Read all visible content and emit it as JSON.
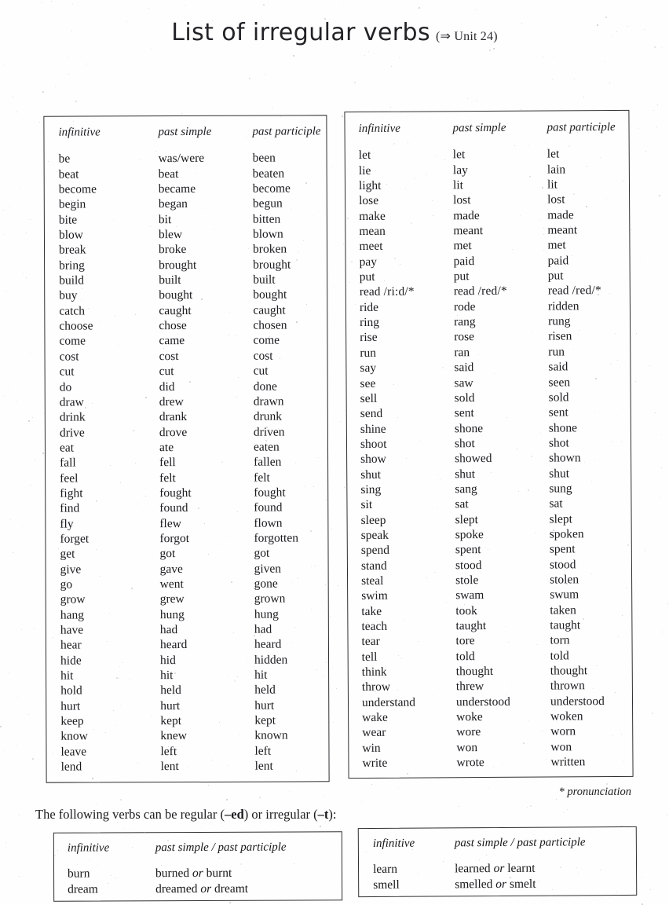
{
  "title": {
    "main": "List of irregular verbs",
    "unit_ref": "(⇒ Unit 24)"
  },
  "columns": {
    "infinitive": "infinitive",
    "past_simple": "past simple",
    "past_participle": "past participle",
    "past_simple_participle": "past simple / past participle"
  },
  "left_table": {
    "rows": [
      {
        "infinitive": "be",
        "past_simple": "was/were",
        "past_participle": "been"
      },
      {
        "infinitive": "beat",
        "past_simple": "beat",
        "past_participle": "beaten"
      },
      {
        "infinitive": "become",
        "past_simple": "became",
        "past_participle": "become"
      },
      {
        "infinitive": "begin",
        "past_simple": "began",
        "past_participle": "begun"
      },
      {
        "infinitive": "bite",
        "past_simple": "bit",
        "past_participle": "bitten"
      },
      {
        "infinitive": "blow",
        "past_simple": "blew",
        "past_participle": "blown"
      },
      {
        "infinitive": "break",
        "past_simple": "broke",
        "past_participle": "broken"
      },
      {
        "infinitive": "bring",
        "past_simple": "brought",
        "past_participle": "brought"
      },
      {
        "infinitive": "build",
        "past_simple": "built",
        "past_participle": "built"
      },
      {
        "infinitive": "buy",
        "past_simple": "bought",
        "past_participle": "bought"
      },
      {
        "infinitive": "catch",
        "past_simple": "caught",
        "past_participle": "caught"
      },
      {
        "infinitive": "choose",
        "past_simple": "chose",
        "past_participle": "chosen"
      },
      {
        "infinitive": "come",
        "past_simple": "came",
        "past_participle": "come"
      },
      {
        "infinitive": "cost",
        "past_simple": "cost",
        "past_participle": "cost"
      },
      {
        "infinitive": "cut",
        "past_simple": "cut",
        "past_participle": "cut"
      },
      {
        "infinitive": "do",
        "past_simple": "did",
        "past_participle": "done"
      },
      {
        "infinitive": "draw",
        "past_simple": "drew",
        "past_participle": "drawn"
      },
      {
        "infinitive": "drink",
        "past_simple": "drank",
        "past_participle": "drunk"
      },
      {
        "infinitive": "drive",
        "past_simple": "drove",
        "past_participle": "driven"
      },
      {
        "infinitive": "eat",
        "past_simple": "ate",
        "past_participle": "eaten"
      },
      {
        "infinitive": "fall",
        "past_simple": "fell",
        "past_participle": "fallen"
      },
      {
        "infinitive": "feel",
        "past_simple": "felt",
        "past_participle": "felt"
      },
      {
        "infinitive": "fight",
        "past_simple": "fought",
        "past_participle": "fought"
      },
      {
        "infinitive": "find",
        "past_simple": "found",
        "past_participle": "found"
      },
      {
        "infinitive": "fly",
        "past_simple": "flew",
        "past_participle": "flown"
      },
      {
        "infinitive": "forget",
        "past_simple": "forgot",
        "past_participle": "forgotten"
      },
      {
        "infinitive": "get",
        "past_simple": "got",
        "past_participle": "got"
      },
      {
        "infinitive": "give",
        "past_simple": "gave",
        "past_participle": "given"
      },
      {
        "infinitive": "go",
        "past_simple": "went",
        "past_participle": "gone"
      },
      {
        "infinitive": "grow",
        "past_simple": "grew",
        "past_participle": "grown"
      },
      {
        "infinitive": "hang",
        "past_simple": "hung",
        "past_participle": "hung"
      },
      {
        "infinitive": "have",
        "past_simple": "had",
        "past_participle": "had"
      },
      {
        "infinitive": "hear",
        "past_simple": "heard",
        "past_participle": "heard"
      },
      {
        "infinitive": "hide",
        "past_simple": "hid",
        "past_participle": "hidden"
      },
      {
        "infinitive": "hit",
        "past_simple": "hit",
        "past_participle": "hit"
      },
      {
        "infinitive": "hold",
        "past_simple": "held",
        "past_participle": "held"
      },
      {
        "infinitive": "hurt",
        "past_simple": "hurt",
        "past_participle": "hurt"
      },
      {
        "infinitive": "keep",
        "past_simple": "kept",
        "past_participle": "kept"
      },
      {
        "infinitive": "know",
        "past_simple": "knew",
        "past_participle": "known"
      },
      {
        "infinitive": "leave",
        "past_simple": "left",
        "past_participle": "left"
      },
      {
        "infinitive": "lend",
        "past_simple": "lent",
        "past_participle": "lent"
      }
    ]
  },
  "right_table": {
    "rows": [
      {
        "infinitive": "let",
        "past_simple": "let",
        "past_participle": "let"
      },
      {
        "infinitive": "lie",
        "past_simple": "lay",
        "past_participle": "lain"
      },
      {
        "infinitive": "light",
        "past_simple": "lit",
        "past_participle": "lit"
      },
      {
        "infinitive": "lose",
        "past_simple": "lost",
        "past_participle": "lost"
      },
      {
        "infinitive": "make",
        "past_simple": "made",
        "past_participle": "made"
      },
      {
        "infinitive": "mean",
        "past_simple": "meant",
        "past_participle": "meant"
      },
      {
        "infinitive": "meet",
        "past_simple": "met",
        "past_participle": "met"
      },
      {
        "infinitive": "pay",
        "past_simple": "paid",
        "past_participle": "paid"
      },
      {
        "infinitive": "put",
        "past_simple": "put",
        "past_participle": "put"
      },
      {
        "infinitive": "read  /ri:d/*",
        "past_simple": "read  /red/*",
        "past_participle": "read  /red/*"
      },
      {
        "infinitive": "ride",
        "past_simple": "rode",
        "past_participle": "ridden"
      },
      {
        "infinitive": "ring",
        "past_simple": "rang",
        "past_participle": "rung"
      },
      {
        "infinitive": "rise",
        "past_simple": "rose",
        "past_participle": "risen"
      },
      {
        "infinitive": "run",
        "past_simple": "ran",
        "past_participle": "run"
      },
      {
        "infinitive": "say",
        "past_simple": "said",
        "past_participle": "said"
      },
      {
        "infinitive": "see",
        "past_simple": "saw",
        "past_participle": "seen"
      },
      {
        "infinitive": "sell",
        "past_simple": "sold",
        "past_participle": "sold"
      },
      {
        "infinitive": "send",
        "past_simple": "sent",
        "past_participle": "sent"
      },
      {
        "infinitive": "shine",
        "past_simple": "shone",
        "past_participle": "shone"
      },
      {
        "infinitive": "shoot",
        "past_simple": "shot",
        "past_participle": "shot"
      },
      {
        "infinitive": "show",
        "past_simple": "showed",
        "past_participle": "shown"
      },
      {
        "infinitive": "shut",
        "past_simple": "shut",
        "past_participle": "shut"
      },
      {
        "infinitive": "sing",
        "past_simple": "sang",
        "past_participle": "sung"
      },
      {
        "infinitive": "sit",
        "past_simple": "sat",
        "past_participle": "sat"
      },
      {
        "infinitive": "sleep",
        "past_simple": "slept",
        "past_participle": "slept"
      },
      {
        "infinitive": "speak",
        "past_simple": "spoke",
        "past_participle": "spoken"
      },
      {
        "infinitive": "spend",
        "past_simple": "spent",
        "past_participle": "spent"
      },
      {
        "infinitive": "stand",
        "past_simple": "stood",
        "past_participle": "stood"
      },
      {
        "infinitive": "steal",
        "past_simple": "stole",
        "past_participle": "stolen"
      },
      {
        "infinitive": "swim",
        "past_simple": "swam",
        "past_participle": "swum"
      },
      {
        "infinitive": "take",
        "past_simple": "took",
        "past_participle": "taken"
      },
      {
        "infinitive": "teach",
        "past_simple": "taught",
        "past_participle": "taught"
      },
      {
        "infinitive": "tear",
        "past_simple": "tore",
        "past_participle": "torn"
      },
      {
        "infinitive": "tell",
        "past_simple": "told",
        "past_participle": "told"
      },
      {
        "infinitive": "think",
        "past_simple": "thought",
        "past_participle": "thought"
      },
      {
        "infinitive": "throw",
        "past_simple": "threw",
        "past_participle": "thrown"
      },
      {
        "infinitive": "understand",
        "past_simple": "understood",
        "past_participle": "understood"
      },
      {
        "infinitive": "wake",
        "past_simple": "woke",
        "past_participle": "woken"
      },
      {
        "infinitive": "wear",
        "past_simple": "wore",
        "past_participle": "worn"
      },
      {
        "infinitive": "win",
        "past_simple": "won",
        "past_participle": "won"
      },
      {
        "infinitive": "write",
        "past_simple": "wrote",
        "past_participle": "written"
      }
    ]
  },
  "pronunciation_note": "* pronunciation",
  "regular_note": {
    "part1": "The following verbs can be regular (",
    "suffix_ed": "–ed",
    "part2": ") or irregular (",
    "suffix_t": "–t",
    "part3": "):"
  },
  "alt_left_table": {
    "rows": [
      {
        "infinitive": "burn",
        "forms_pre": "burned ",
        "or": "or",
        "forms_post": " burnt"
      },
      {
        "infinitive": "dream",
        "forms_pre": "dreamed ",
        "or": "or",
        "forms_post": " dreamt"
      }
    ]
  },
  "alt_right_table": {
    "rows": [
      {
        "infinitive": "learn",
        "forms_pre": "learned ",
        "or": "or",
        "forms_post": " learnt"
      },
      {
        "infinitive": "smell",
        "forms_pre": "smelled ",
        "or": "or",
        "forms_post": " smelt"
      }
    ]
  }
}
